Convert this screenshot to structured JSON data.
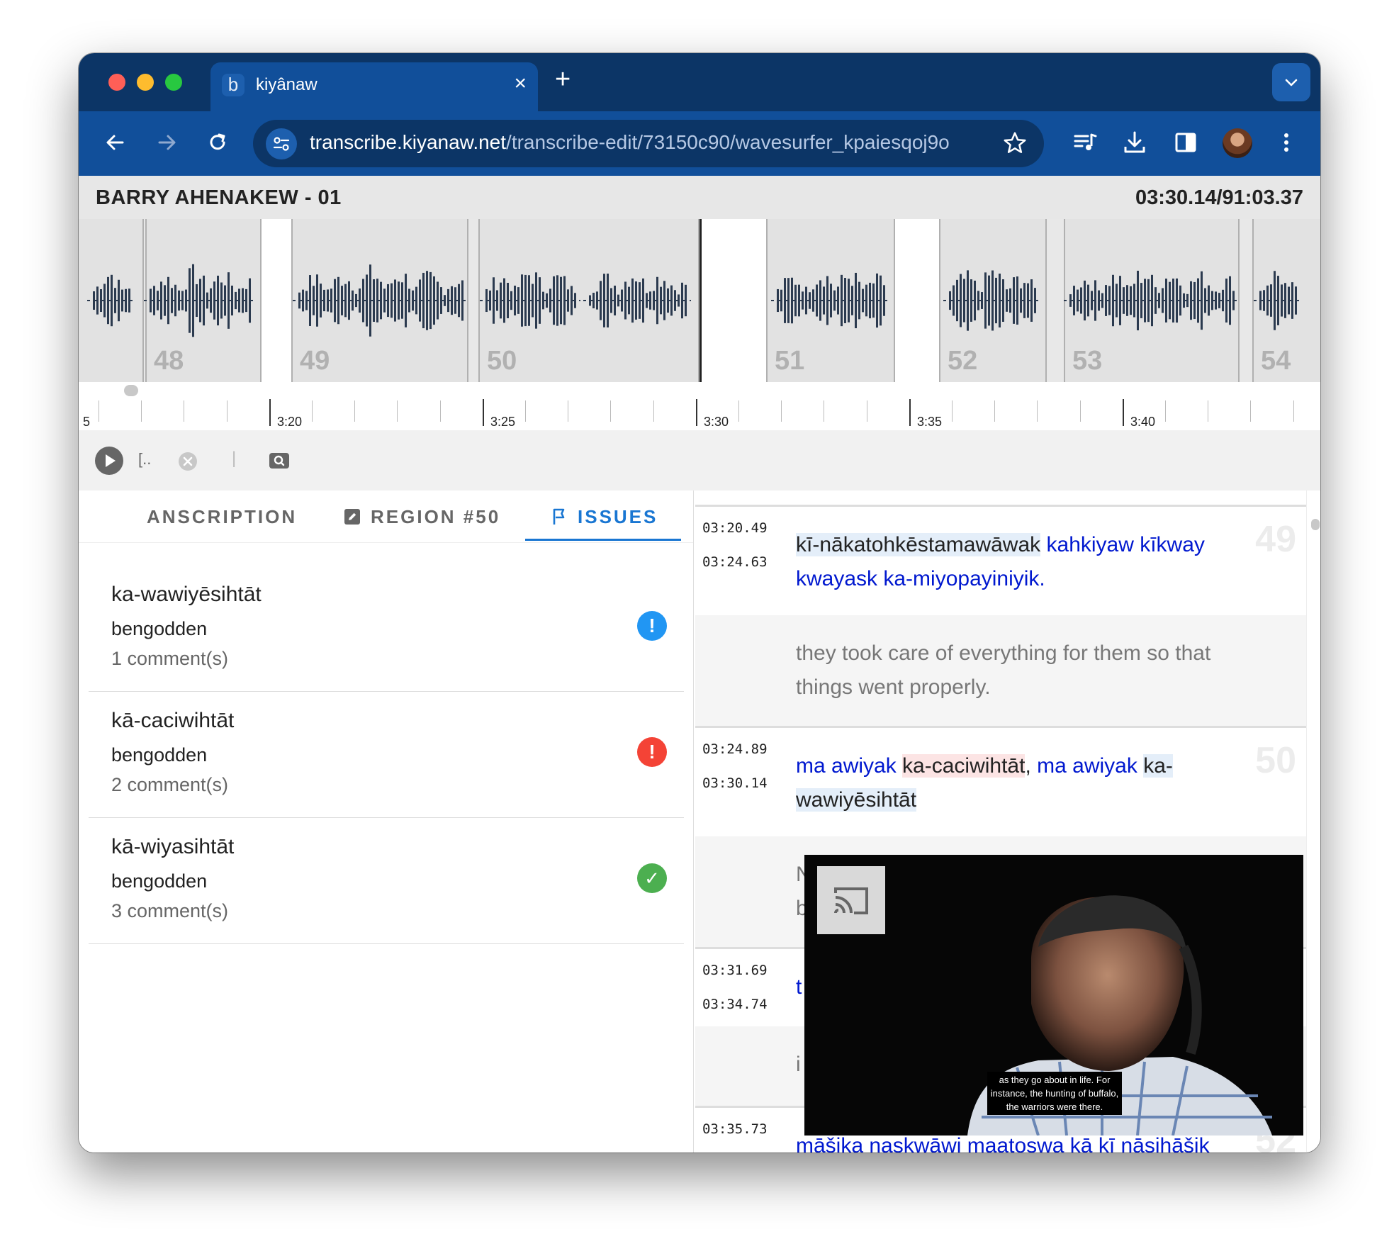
{
  "browser": {
    "tab_title": "kiyânaw",
    "tab_favicon": "b",
    "tab_close": "×",
    "new_tab": "+",
    "url_host": "transcribe.kiyanaw.net",
    "url_path": "/transcribe-edit/73150c90/wavesurfer_kpaiesqoj9o"
  },
  "header": {
    "title": "BARRY AHENAKEW - 01",
    "time": "03:30.14/91:03.37"
  },
  "waveform": {
    "region_labels": [
      "48",
      "49",
      "50",
      "51",
      "52",
      "53",
      "54"
    ],
    "color": "#2b3a4f"
  },
  "timeline": {
    "labels": [
      "5",
      "3:20",
      "3:25",
      "3:30",
      "3:35",
      "3:40"
    ]
  },
  "controls": {
    "bracket_label": "[..",
    "separator": "|"
  },
  "tabs": {
    "transcription": "ANSCRIPTION",
    "region": "REGION #50",
    "issues": "ISSUES"
  },
  "issues": [
    {
      "word": "ka-wawiyēsihtāt",
      "user": "bengodden",
      "comments": "1 comment(s)",
      "status": "info",
      "color": "#2196f3",
      "symbol": "!"
    },
    {
      "word": "kā-caciwihtāt",
      "user": "bengodden",
      "comments": "2 comment(s)",
      "status": "error",
      "color": "#f44336",
      "symbol": "!"
    },
    {
      "word": "kā-wiyasihtāt",
      "user": "bengodden",
      "comments": "3 comment(s)",
      "status": "resolved",
      "color": "#4caf50",
      "symbol": "✓"
    }
  ],
  "regions": [
    {
      "start": "03:20.49",
      "end": "03:24.63",
      "number": "49",
      "text_a": "kī-nākatohkēstamawāwak",
      "text_b": " kahkiyaw kīkway kwayask ka-miyopayiniyik.",
      "translation": "they took care of everything for them so that things went properly."
    },
    {
      "start": "03:24.89",
      "end": "03:30.14",
      "number": "50",
      "text_a": "ma awiyak ",
      "text_b": "ka-caciwihtāt",
      "text_c": ",",
      "text_d": " ma awiyak ",
      "text_e": "ka-wawiyēsihtāt",
      "translation_fragment_1": "N",
      "translation_fragment_2": "b"
    },
    {
      "start": "03:31.69",
      "end": "03:34.74",
      "text_fragment": "t",
      "translation_fragment": "i"
    },
    {
      "start": "03:35.73",
      "text": "māšika naskwāwi maatoswa kā kī nāsihāšik",
      "number": "52"
    }
  ],
  "video": {
    "caption": "as they go about in life. For instance, the hunting of buffalo, the warriors were there."
  }
}
